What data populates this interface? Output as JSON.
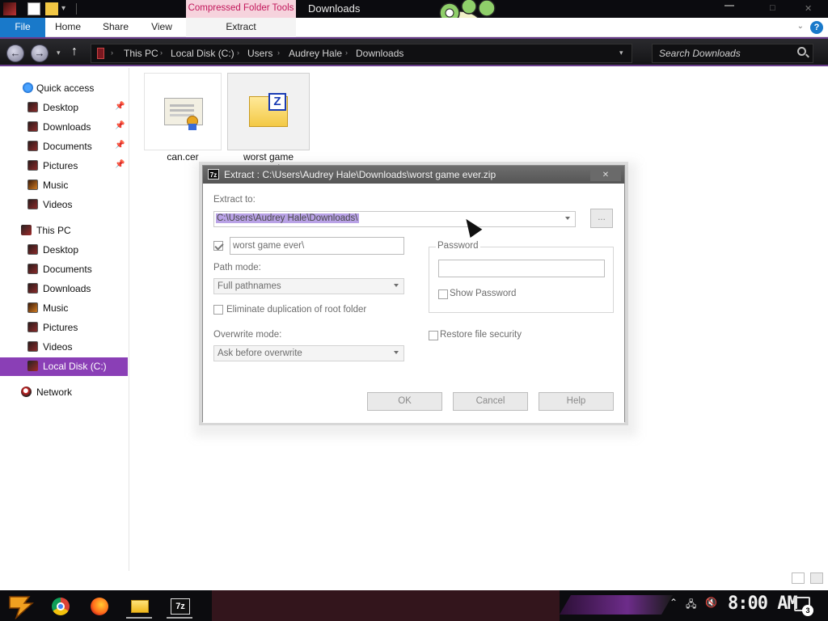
{
  "window": {
    "title": "Downloads",
    "context_tab": "Compressed Folder Tools"
  },
  "ribbon": {
    "tabs": [
      "File",
      "Home",
      "Share",
      "View",
      "Extract"
    ]
  },
  "address": {
    "crumbs": [
      "This PC",
      "Local Disk (C:)",
      "Users",
      "Audrey Hale",
      "Downloads"
    ],
    "search_placeholder": "Search Downloads"
  },
  "nav": {
    "quick_access": "Quick access",
    "quick_items": [
      "Desktop",
      "Downloads",
      "Documents",
      "Pictures",
      "Music",
      "Videos"
    ],
    "this_pc": "This PC",
    "pc_items": [
      "Desktop",
      "Documents",
      "Downloads",
      "Music",
      "Pictures",
      "Videos",
      "Local Disk (C:)"
    ],
    "network": "Network",
    "accent": "#8a3fb6"
  },
  "files": [
    {
      "name": "can.cer",
      "icon": "certificate-icon"
    },
    {
      "name": "worst game ever.zip",
      "icon": "zip-folder-icon"
    }
  ],
  "dialog": {
    "title": "Extract : C:\\Users\\Audrey Hale\\Downloads\\worst game ever.zip",
    "extract_to_label": "Extract to:",
    "extract_to_value": "C:\\Users\\Audrey Hale\\Downloads\\",
    "browse_label": "...",
    "subfolder_value": "worst game ever\\",
    "subfolder_checked": true,
    "path_mode_label": "Path mode:",
    "path_mode_value": "Full pathnames",
    "eliminate_label": "Eliminate duplication of root folder",
    "overwrite_label": "Overwrite mode:",
    "overwrite_value": "Ask before overwrite",
    "password_group": "Password",
    "show_password_label": "Show Password",
    "restore_security_label": "Restore file security",
    "ok_label": "OK",
    "cancel_label": "Cancel",
    "help_label": "Help"
  },
  "taskbar": {
    "apps": [
      "chrome-icon",
      "firefox-icon",
      "file-explorer-icon",
      "7zip-icon"
    ],
    "clock": "8:00 AM",
    "notification_count": "3"
  }
}
